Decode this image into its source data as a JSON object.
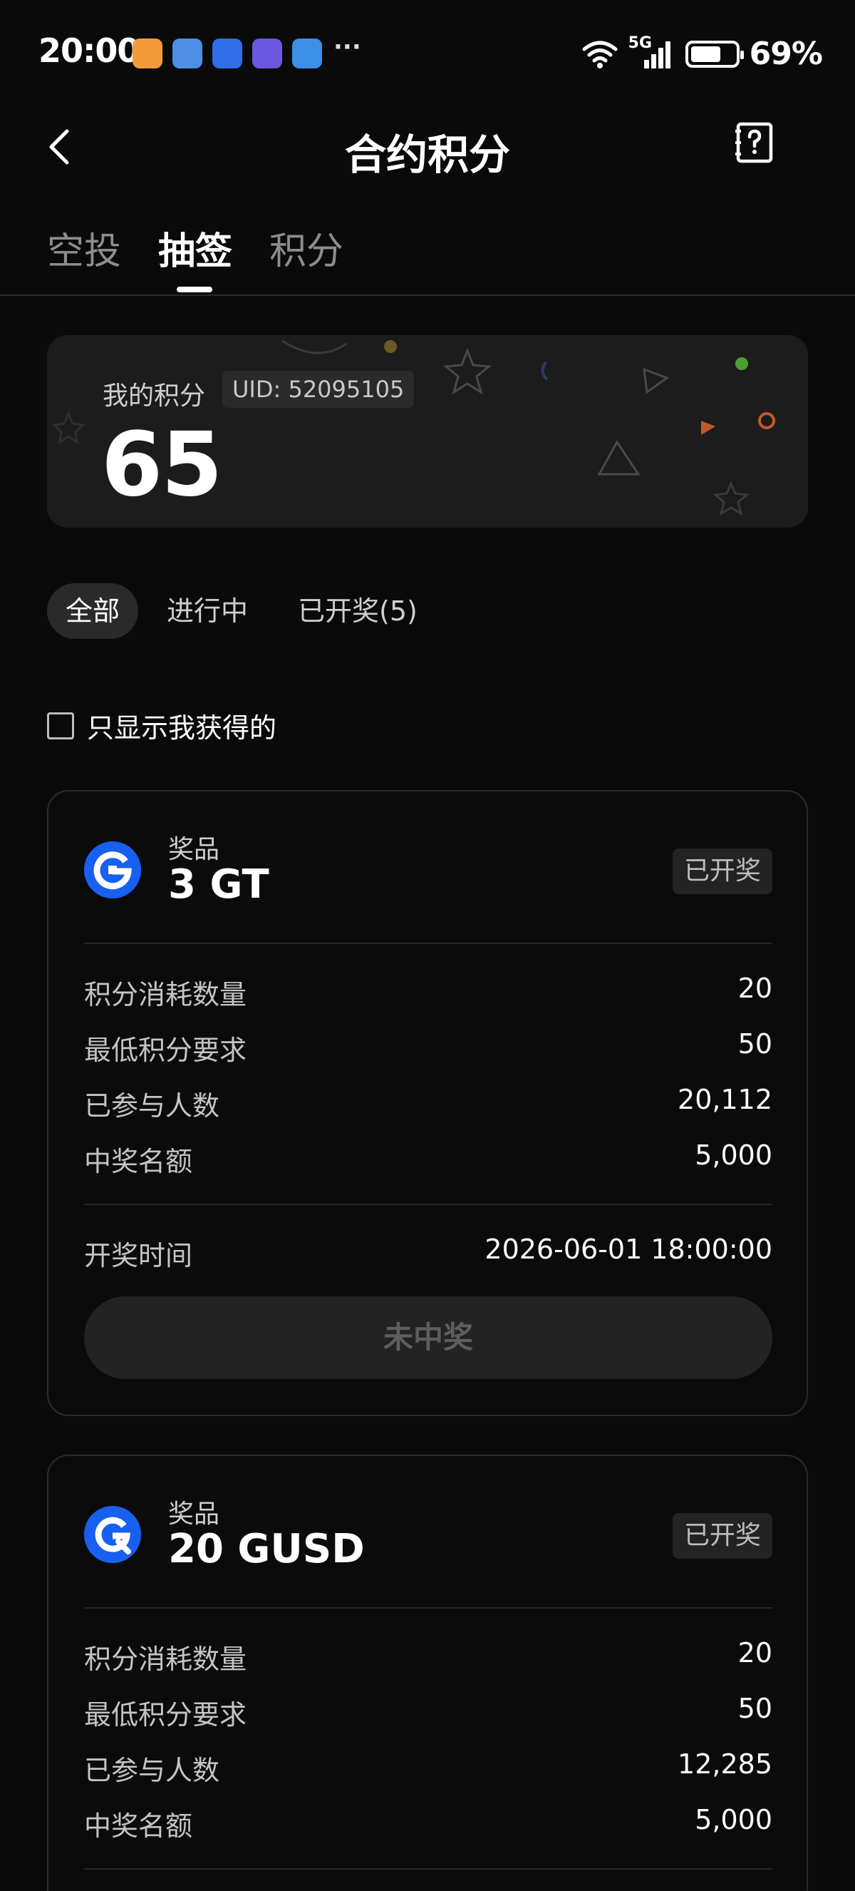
{
  "status_bar": {
    "time": "20:00",
    "network": "5G",
    "battery": "69%",
    "battery_level": 0.69,
    "more": "···"
  },
  "nav": {
    "title": "合约积分",
    "back_icon": "back-arrow-icon",
    "help_icon": "help-book-icon"
  },
  "tabs": [
    {
      "label": "空投",
      "active": false
    },
    {
      "label": "抽签",
      "active": true
    },
    {
      "label": "积分",
      "active": false
    }
  ],
  "points": {
    "label": "我的积分",
    "uid": "UID: 52095105",
    "value": "65"
  },
  "filters": [
    {
      "label": "全部",
      "active": true
    },
    {
      "label": "进行中",
      "active": false
    },
    {
      "label": "已开奖(5)",
      "active": false
    }
  ],
  "only_mine": {
    "label": "只显示我获得的",
    "checked": false
  },
  "prizes": [
    {
      "caption": "奖品",
      "name": "3 GT",
      "status": "已开奖",
      "rows": [
        {
          "label": "积分消耗数量",
          "value": "20"
        },
        {
          "label": "最低积分要求",
          "value": "50"
        },
        {
          "label": "已参与人数",
          "value": "20,112"
        },
        {
          "label": "中奖名额",
          "value": "5,000"
        }
      ],
      "draw_time_label": "开奖时间",
      "draw_time": "2026-06-01 18:00:00",
      "result": "未中奖"
    },
    {
      "caption": "奖品",
      "name": "20 GUSD",
      "status": "已开奖",
      "rows": [
        {
          "label": "积分消耗数量",
          "value": "20"
        },
        {
          "label": "最低积分要求",
          "value": "50"
        },
        {
          "label": "已参与人数",
          "value": "12,285"
        },
        {
          "label": "中奖名额",
          "value": "5,000"
        }
      ]
    }
  ]
}
